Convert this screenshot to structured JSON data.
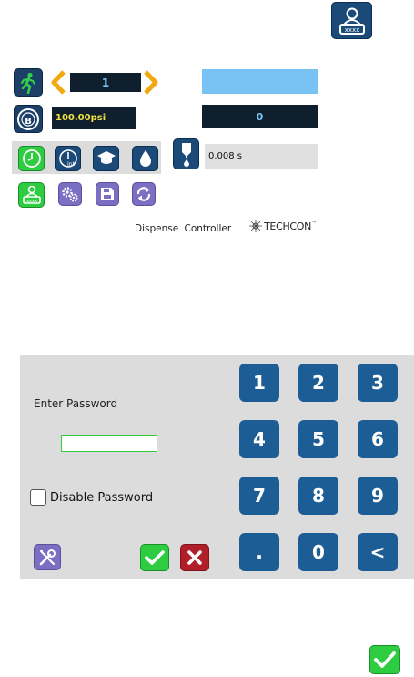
{
  "user_profile": {
    "icon": "operator-badge-icon"
  },
  "controls": {
    "program_number": "1",
    "program_name": "",
    "pressure": "100.00psi",
    "counter": "0",
    "dispense_time": "0.008 s"
  },
  "branding": {
    "title": "Dispense Controller",
    "logo_text": "TECHCON",
    "logo_tm": "™"
  },
  "password_dialog": {
    "prompt": "Enter Password",
    "input_value": "",
    "disable_label": "Disable Password",
    "disable_checked": false,
    "keys": [
      "1",
      "2",
      "3",
      "4",
      "5",
      "6",
      "7",
      "8",
      "9",
      ".",
      "0",
      "<"
    ]
  },
  "colors": {
    "run_navy": "#1b3f67",
    "arrow_orange": "#f0a90e",
    "light_blue_field": "#79c2f4",
    "pressure_text": "#f0e040",
    "green": "#2ecc40",
    "purple": "#7a6fc2",
    "key_blue": "#1d5d95",
    "red": "#b01e2a"
  }
}
